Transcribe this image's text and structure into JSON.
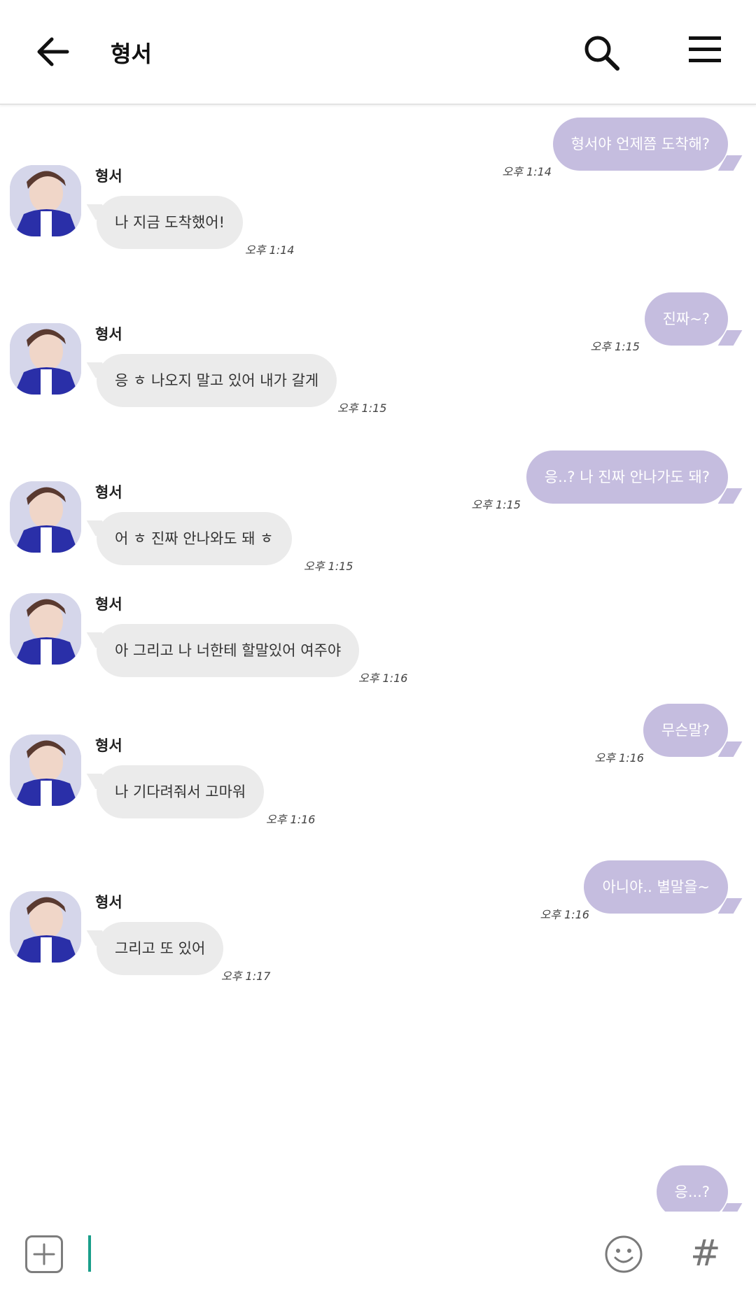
{
  "header": {
    "title": "형서"
  },
  "contact": {
    "name": "형서"
  },
  "messages": [
    {
      "dir": "out",
      "text": "형서야 언제쯤 도착해?",
      "time": "오후 1:14"
    },
    {
      "dir": "in",
      "text": "나 지금 도착했어!",
      "time": "오후 1:14"
    },
    {
      "dir": "out",
      "text": "진짜~?",
      "time": "오후 1:15"
    },
    {
      "dir": "in",
      "text": "응 ㅎ 나오지 말고 있어 내가 갈게",
      "time": "오후 1:15"
    },
    {
      "dir": "out",
      "text": "응..? 나 진짜 안나가도 돼?",
      "time": "오후 1:15"
    },
    {
      "dir": "in",
      "text": "어 ㅎ 진짜 안나와도 돼 ㅎ",
      "time": "오후 1:15"
    },
    {
      "dir": "in",
      "text": "아 그리고 나 너한테 할말있어 여주야",
      "time": "오후 1:16"
    },
    {
      "dir": "out",
      "text": "무슨말?",
      "time": "오후 1:16"
    },
    {
      "dir": "in",
      "text": "나 기다려줘서 고마워",
      "time": "오후 1:16"
    },
    {
      "dir": "out",
      "text": "아니야.. 별말을~",
      "time": "오후 1:16"
    },
    {
      "dir": "in",
      "text": "그리고 또 있어",
      "time": "오후 1:17"
    },
    {
      "dir": "out",
      "text": "응...?",
      "time": ""
    }
  ],
  "icons": {
    "back": "arrow-left-icon",
    "search": "search-icon",
    "menu": "hamburger-menu-icon",
    "attach": "plus-square-icon",
    "emoji": "smiley-icon",
    "hashtag": "hashtag-icon"
  },
  "colors": {
    "outgoing_bubble": "#c5bddf",
    "incoming_bubble": "#ebebeb",
    "cursor": "#1a9e8a"
  },
  "footer": {
    "hashtag_symbol": "#"
  }
}
